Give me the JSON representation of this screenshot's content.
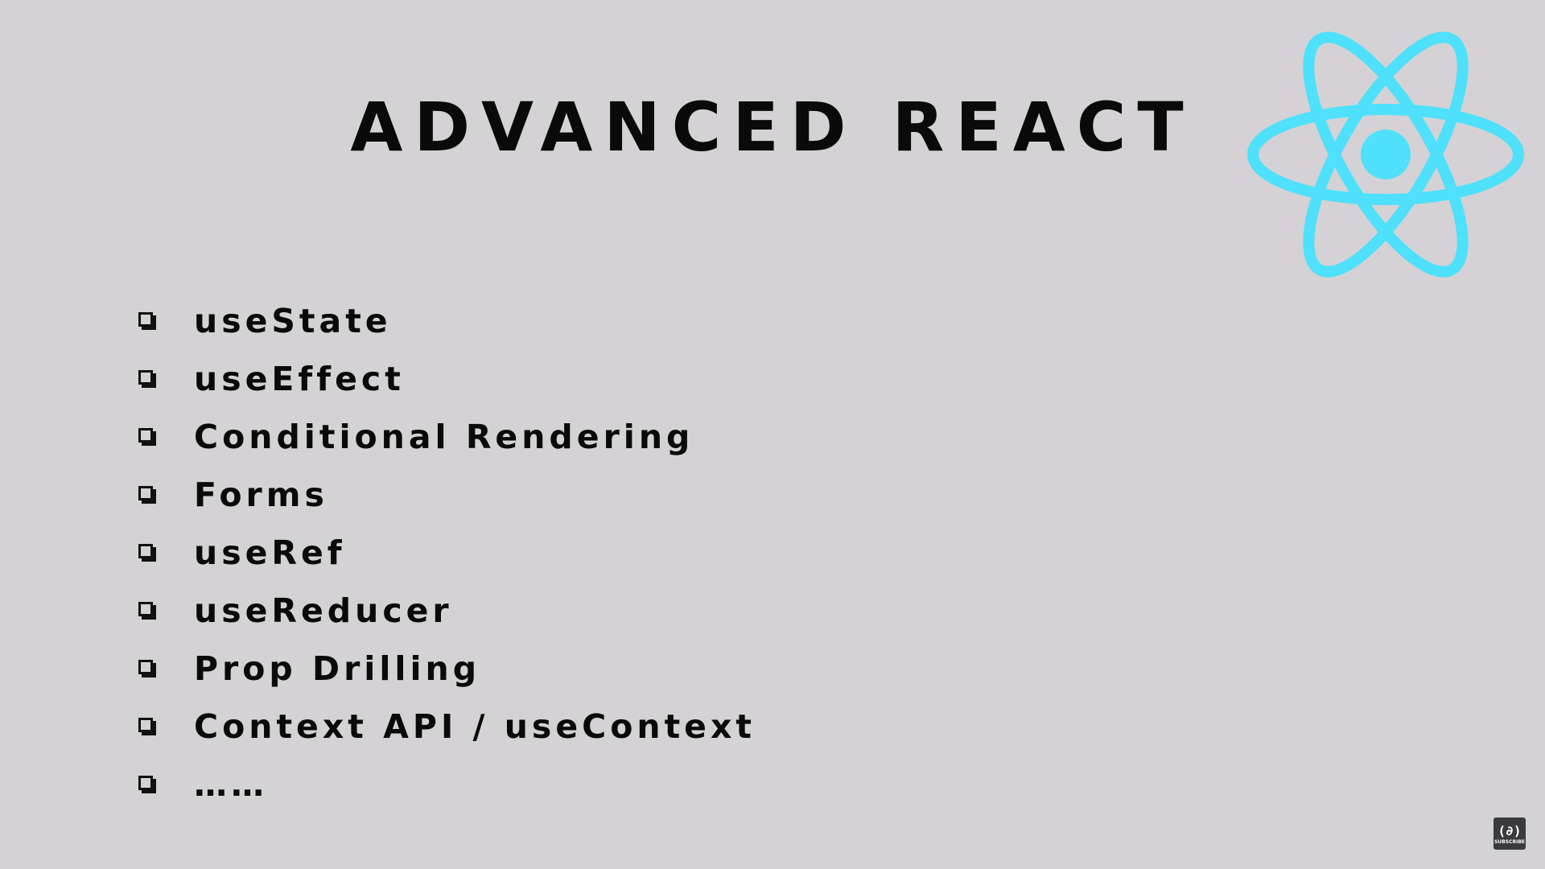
{
  "slide": {
    "title": "ADVANCED REACT",
    "topics": [
      {
        "label": "useState"
      },
      {
        "label": "useEffect"
      },
      {
        "label": "Conditional Rendering"
      },
      {
        "label": "Forms"
      },
      {
        "label": "useRef"
      },
      {
        "label": "useReducer"
      },
      {
        "label": "Prop Drilling"
      },
      {
        "label": "Context API / useContext"
      },
      {
        "label": "……"
      }
    ],
    "logo": {
      "icon": "react-logo-icon",
      "color": "#4fe0fb"
    }
  },
  "subscribe_badge": {
    "glyph": "(∂)",
    "label": "SUBSCRIBE",
    "icon": "freecodecamp-flame-icon"
  },
  "colors": {
    "background": "#d4d2d5",
    "text": "#0a0a0a",
    "accent": "#4fe0fb",
    "badge": "#3a3a3f"
  }
}
